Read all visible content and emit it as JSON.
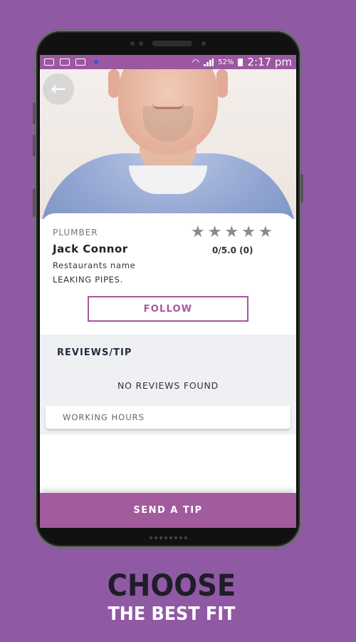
{
  "status_bar": {
    "battery": "52%",
    "time": "2:17 pm",
    "icons": [
      "youtube-icon",
      "image-icon",
      "gallery-icon",
      "notification-dot",
      "wifi-icon",
      "signal-icon",
      "battery-icon"
    ]
  },
  "profile": {
    "category": "PLUMBER",
    "name": "Jack Connor",
    "business": "Restaurants name",
    "description": "LEAKING PIPES.",
    "rating_text": "0/5.0 (0)",
    "stars": 0,
    "stars_max": 5,
    "follow_label": "FOLLOW"
  },
  "reviews": {
    "title": "REVIEWS/TIP",
    "empty_text": "NO REVIEWS FOUND",
    "working_hours_label": "WORKING HOURS"
  },
  "actions": {
    "send_tip_label": "SEND A TIP"
  },
  "tagline": {
    "line1": "CHOOSE",
    "line2": "THE BEST FIT"
  },
  "colors": {
    "background": "#9059a4",
    "accent": "#a25b9c",
    "status_bar": "#9b57a0",
    "star": "#8a8a8a"
  }
}
